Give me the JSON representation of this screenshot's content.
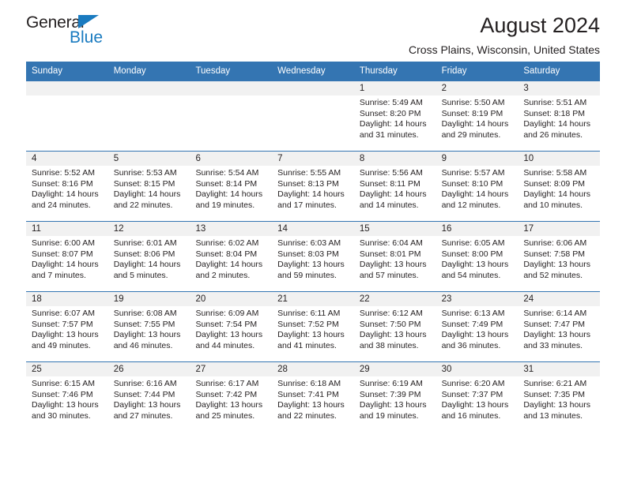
{
  "brand": {
    "name_part1": "General",
    "name_part2": "Blue",
    "triangle_color": "#1a7bc0"
  },
  "header": {
    "title": "August 2024",
    "subtitle": "Cross Plains, Wisconsin, United States"
  },
  "colors": {
    "header_band": "#3475b2",
    "day_band": "#f1f1f1",
    "text": "#231f20",
    "brand_blue": "#1a7bc0"
  },
  "weekdays": [
    "Sunday",
    "Monday",
    "Tuesday",
    "Wednesday",
    "Thursday",
    "Friday",
    "Saturday"
  ],
  "weeks": [
    [
      {
        "day": "",
        "sunrise": "",
        "sunset": "",
        "daylight": ""
      },
      {
        "day": "",
        "sunrise": "",
        "sunset": "",
        "daylight": ""
      },
      {
        "day": "",
        "sunrise": "",
        "sunset": "",
        "daylight": ""
      },
      {
        "day": "",
        "sunrise": "",
        "sunset": "",
        "daylight": ""
      },
      {
        "day": "1",
        "sunrise": "Sunrise: 5:49 AM",
        "sunset": "Sunset: 8:20 PM",
        "daylight": "Daylight: 14 hours and 31 minutes."
      },
      {
        "day": "2",
        "sunrise": "Sunrise: 5:50 AM",
        "sunset": "Sunset: 8:19 PM",
        "daylight": "Daylight: 14 hours and 29 minutes."
      },
      {
        "day": "3",
        "sunrise": "Sunrise: 5:51 AM",
        "sunset": "Sunset: 8:18 PM",
        "daylight": "Daylight: 14 hours and 26 minutes."
      }
    ],
    [
      {
        "day": "4",
        "sunrise": "Sunrise: 5:52 AM",
        "sunset": "Sunset: 8:16 PM",
        "daylight": "Daylight: 14 hours and 24 minutes."
      },
      {
        "day": "5",
        "sunrise": "Sunrise: 5:53 AM",
        "sunset": "Sunset: 8:15 PM",
        "daylight": "Daylight: 14 hours and 22 minutes."
      },
      {
        "day": "6",
        "sunrise": "Sunrise: 5:54 AM",
        "sunset": "Sunset: 8:14 PM",
        "daylight": "Daylight: 14 hours and 19 minutes."
      },
      {
        "day": "7",
        "sunrise": "Sunrise: 5:55 AM",
        "sunset": "Sunset: 8:13 PM",
        "daylight": "Daylight: 14 hours and 17 minutes."
      },
      {
        "day": "8",
        "sunrise": "Sunrise: 5:56 AM",
        "sunset": "Sunset: 8:11 PM",
        "daylight": "Daylight: 14 hours and 14 minutes."
      },
      {
        "day": "9",
        "sunrise": "Sunrise: 5:57 AM",
        "sunset": "Sunset: 8:10 PM",
        "daylight": "Daylight: 14 hours and 12 minutes."
      },
      {
        "day": "10",
        "sunrise": "Sunrise: 5:58 AM",
        "sunset": "Sunset: 8:09 PM",
        "daylight": "Daylight: 14 hours and 10 minutes."
      }
    ],
    [
      {
        "day": "11",
        "sunrise": "Sunrise: 6:00 AM",
        "sunset": "Sunset: 8:07 PM",
        "daylight": "Daylight: 14 hours and 7 minutes."
      },
      {
        "day": "12",
        "sunrise": "Sunrise: 6:01 AM",
        "sunset": "Sunset: 8:06 PM",
        "daylight": "Daylight: 14 hours and 5 minutes."
      },
      {
        "day": "13",
        "sunrise": "Sunrise: 6:02 AM",
        "sunset": "Sunset: 8:04 PM",
        "daylight": "Daylight: 14 hours and 2 minutes."
      },
      {
        "day": "14",
        "sunrise": "Sunrise: 6:03 AM",
        "sunset": "Sunset: 8:03 PM",
        "daylight": "Daylight: 13 hours and 59 minutes."
      },
      {
        "day": "15",
        "sunrise": "Sunrise: 6:04 AM",
        "sunset": "Sunset: 8:01 PM",
        "daylight": "Daylight: 13 hours and 57 minutes."
      },
      {
        "day": "16",
        "sunrise": "Sunrise: 6:05 AM",
        "sunset": "Sunset: 8:00 PM",
        "daylight": "Daylight: 13 hours and 54 minutes."
      },
      {
        "day": "17",
        "sunrise": "Sunrise: 6:06 AM",
        "sunset": "Sunset: 7:58 PM",
        "daylight": "Daylight: 13 hours and 52 minutes."
      }
    ],
    [
      {
        "day": "18",
        "sunrise": "Sunrise: 6:07 AM",
        "sunset": "Sunset: 7:57 PM",
        "daylight": "Daylight: 13 hours and 49 minutes."
      },
      {
        "day": "19",
        "sunrise": "Sunrise: 6:08 AM",
        "sunset": "Sunset: 7:55 PM",
        "daylight": "Daylight: 13 hours and 46 minutes."
      },
      {
        "day": "20",
        "sunrise": "Sunrise: 6:09 AM",
        "sunset": "Sunset: 7:54 PM",
        "daylight": "Daylight: 13 hours and 44 minutes."
      },
      {
        "day": "21",
        "sunrise": "Sunrise: 6:11 AM",
        "sunset": "Sunset: 7:52 PM",
        "daylight": "Daylight: 13 hours and 41 minutes."
      },
      {
        "day": "22",
        "sunrise": "Sunrise: 6:12 AM",
        "sunset": "Sunset: 7:50 PM",
        "daylight": "Daylight: 13 hours and 38 minutes."
      },
      {
        "day": "23",
        "sunrise": "Sunrise: 6:13 AM",
        "sunset": "Sunset: 7:49 PM",
        "daylight": "Daylight: 13 hours and 36 minutes."
      },
      {
        "day": "24",
        "sunrise": "Sunrise: 6:14 AM",
        "sunset": "Sunset: 7:47 PM",
        "daylight": "Daylight: 13 hours and 33 minutes."
      }
    ],
    [
      {
        "day": "25",
        "sunrise": "Sunrise: 6:15 AM",
        "sunset": "Sunset: 7:46 PM",
        "daylight": "Daylight: 13 hours and 30 minutes."
      },
      {
        "day": "26",
        "sunrise": "Sunrise: 6:16 AM",
        "sunset": "Sunset: 7:44 PM",
        "daylight": "Daylight: 13 hours and 27 minutes."
      },
      {
        "day": "27",
        "sunrise": "Sunrise: 6:17 AM",
        "sunset": "Sunset: 7:42 PM",
        "daylight": "Daylight: 13 hours and 25 minutes."
      },
      {
        "day": "28",
        "sunrise": "Sunrise: 6:18 AM",
        "sunset": "Sunset: 7:41 PM",
        "daylight": "Daylight: 13 hours and 22 minutes."
      },
      {
        "day": "29",
        "sunrise": "Sunrise: 6:19 AM",
        "sunset": "Sunset: 7:39 PM",
        "daylight": "Daylight: 13 hours and 19 minutes."
      },
      {
        "day": "30",
        "sunrise": "Sunrise: 6:20 AM",
        "sunset": "Sunset: 7:37 PM",
        "daylight": "Daylight: 13 hours and 16 minutes."
      },
      {
        "day": "31",
        "sunrise": "Sunrise: 6:21 AM",
        "sunset": "Sunset: 7:35 PM",
        "daylight": "Daylight: 13 hours and 13 minutes."
      }
    ]
  ]
}
